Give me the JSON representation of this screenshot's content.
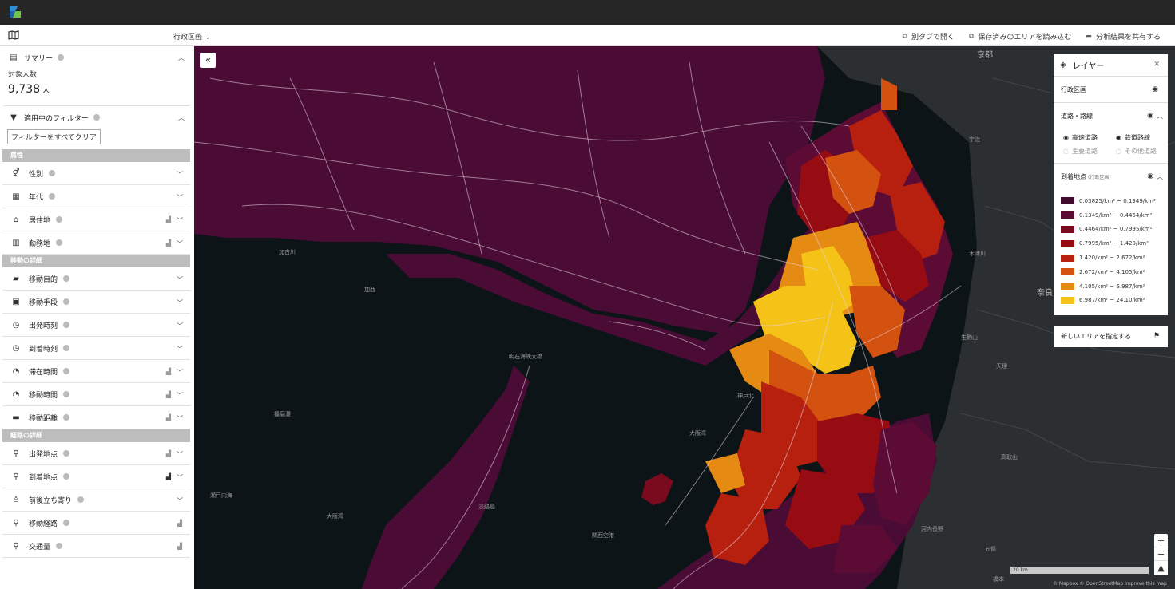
{
  "toolbar": {
    "layer_select": "行政区画",
    "actions": {
      "open_new_tab": "別タブで開く",
      "load_saved_area": "保存済みのエリアを読み込む",
      "share_results": "分析結果を共有する"
    }
  },
  "sidebar": {
    "summary": {
      "title": "サマリー",
      "label": "対象人数",
      "value": "9,738",
      "unit": "人"
    },
    "filters": {
      "title": "適用中のフィルター",
      "clear_button": "フィルターをすべてクリア"
    },
    "groups": [
      {
        "title": "属性",
        "items": [
          "性別",
          "年代",
          "居住地",
          "勤務地"
        ]
      },
      {
        "title": "移動の詳細",
        "items": [
          "移動目的",
          "移動手段",
          "出発時刻",
          "到着時刻",
          "滞在時間",
          "移動時間",
          "移動距離"
        ]
      },
      {
        "title": "経路の詳細",
        "items": [
          "出発地点",
          "到着地点",
          "前後立ち寄り",
          "移動経路",
          "交通量"
        ]
      }
    ]
  },
  "layers_panel": {
    "title": "レイヤー",
    "admin": "行政区画",
    "roads": "道路・路線",
    "road_types": {
      "expressway": "高速道路",
      "railway": "鉄道路線",
      "main_road": "主要道路",
      "other_road": "その他道路"
    },
    "arrival": "到着地点",
    "arrival_note": "(行政区画)",
    "legend": [
      {
        "range": "0.03825/km² ~ 0.1349/km²",
        "color": "#3f0a2c"
      },
      {
        "range": "0.1349/km² ~ 0.4464/km²",
        "color": "#5c0b35"
      },
      {
        "range": "0.4464/km² ~ 0.7995/km²",
        "color": "#7a0a1e"
      },
      {
        "range": "0.7995/km² ~ 1.420/km²",
        "color": "#960c12"
      },
      {
        "range": "1.420/km² ~ 2.672/km²",
        "color": "#b7200f"
      },
      {
        "range": "2.672/km² ~ 4.105/km²",
        "color": "#d4520f"
      },
      {
        "range": "4.105/km² ~ 6.987/km²",
        "color": "#e58a12"
      },
      {
        "range": "6.987/km² ~ 24.10/km²",
        "color": "#f5c218"
      }
    ],
    "new_area": "新しいエリアを指定する"
  },
  "map": {
    "labels": {
      "kyoto": "京都",
      "nara": "奈良",
      "osaka_bay": "大阪湾",
      "harima": "播磨灘",
      "setonaikai": "瀬戸内海",
      "osaka_bay2": "大阪湾",
      "akashi_bridge": "明石海峡大橋",
      "tenri": "天理",
      "kanku": "関西空港",
      "takatori": "高取山",
      "uji": "宇治",
      "kizu": "木津川",
      "ikoma": "生駒山",
      "kobe_n": "神戸北",
      "kaga": "加古川",
      "awaji": "淡路島",
      "kasai": "加西",
      "gojo": "五條",
      "kawachi": "河内長野",
      "hashimoto": "橋本"
    },
    "scale": "20 km",
    "attribution": "© Mapbox © OpenStreetMap  Improve this map"
  }
}
